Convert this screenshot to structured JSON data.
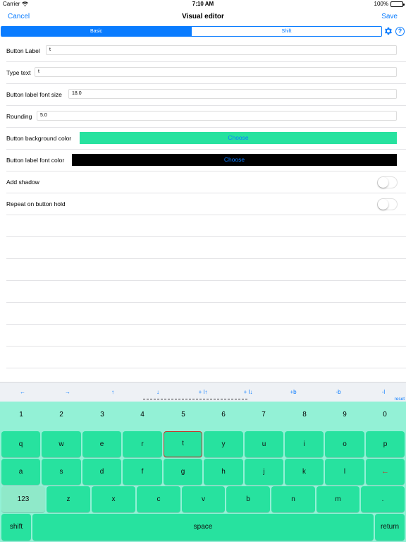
{
  "status": {
    "carrier": "Carrier",
    "time": "7:10 AM",
    "battery": "100%"
  },
  "nav": {
    "cancel": "Cancel",
    "title": "Visual editor",
    "save": "Save"
  },
  "segments": {
    "basic": "Basic",
    "shift": "Shift"
  },
  "form": {
    "button_label": {
      "label": "Button Label",
      "value": "t"
    },
    "type_text": {
      "label": "Type text",
      "value": "t"
    },
    "font_size": {
      "label": "Button label font size",
      "value": "18.0"
    },
    "rounding": {
      "label": "Rounding",
      "value": "5.0"
    },
    "bg_color": {
      "label": "Button background color",
      "button": "Choose",
      "color": "#27e29f"
    },
    "font_color": {
      "label": "Button label font color",
      "button": "Choose",
      "color": "#000000"
    },
    "add_shadow": {
      "label": "Add shadow",
      "on": false
    },
    "repeat_hold": {
      "label": "Repeat on button hold",
      "on": false
    }
  },
  "arrows": [
    "←",
    "→",
    "↑",
    "↓",
    "+ l↑",
    "+ l↓",
    "+b",
    "-b",
    "-l"
  ],
  "reset": "reset",
  "keyboard": {
    "numbers": [
      "1",
      "2",
      "3",
      "4",
      "5",
      "6",
      "7",
      "8",
      "9",
      "0"
    ],
    "row1": [
      "q",
      "w",
      "e",
      "r",
      "t",
      "y",
      "u",
      "i",
      "o",
      "p"
    ],
    "row2": [
      "a",
      "s",
      "d",
      "f",
      "g",
      "h",
      "j",
      "k",
      "l"
    ],
    "row3": [
      "z",
      "x",
      "c",
      "v",
      "b",
      "n",
      "m",
      "."
    ],
    "key_123": "123",
    "shift": "shift",
    "space": "space",
    "return": "return",
    "backspace_icon": "left-arrow",
    "selected_key": "t"
  },
  "colors": {
    "accent": "#0a7cff",
    "key": "#27e29f",
    "keyboard_bg": "#93f1d6"
  }
}
